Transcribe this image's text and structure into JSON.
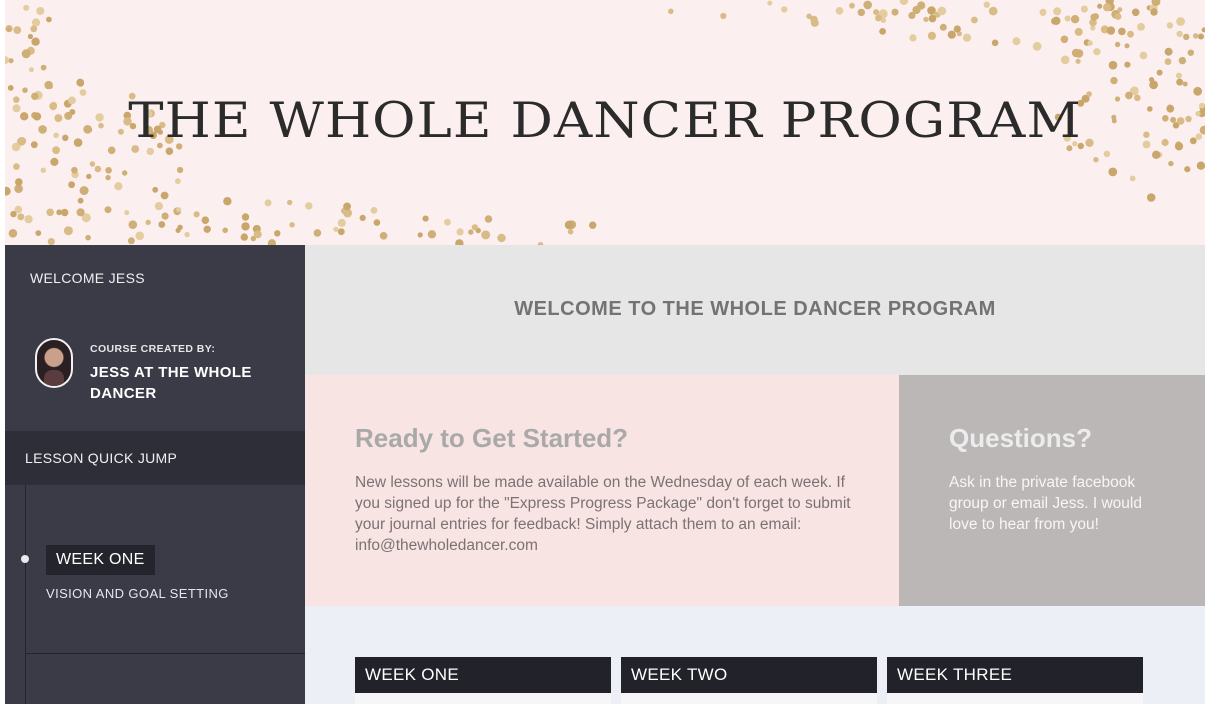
{
  "colors": {
    "hero_bg": "#fcefef",
    "confetti_gold": "#cfaf78",
    "sidebar_bg": "#3a3b47",
    "sidebar_dark": "#2d2e37",
    "header_bg": "#e6e6e6",
    "ready_bg": "#f9e4e4",
    "questions_bg": "#bbb7b6",
    "weeks_bg": "#edeff6",
    "week_card_header": "#22222a"
  },
  "hero": {
    "title": "THE WHOLE DANCER PROGRAM"
  },
  "sidebar": {
    "welcome": "WELCOME JESS",
    "creator_caption": "COURSE CREATED BY:",
    "creator_name": "JESS AT THE WHOLE DANCER",
    "avatar_icon": "profile-photo",
    "quick_jump_label": "LESSON QUICK JUMP",
    "lessons": [
      {
        "week": "WEEK ONE",
        "subtitle": "VISION AND GOAL SETTING",
        "active": true
      }
    ]
  },
  "main": {
    "header_title": "WELCOME TO THE WHOLE DANCER PROGRAM",
    "ready": {
      "title": "Ready to Get Started?",
      "body": "New lessons will be made available on the Wednesday of each week. If you signed up for the \"Express Progress Package\" don't forget to submit your journal entries for feedback! Simply attach them to an email: info@thewholedancer.com"
    },
    "questions": {
      "title": "Questions?",
      "body": "Ask in the private facebook group or email Jess. I would love to hear from you!"
    },
    "week_cards": [
      {
        "label": "WEEK ONE"
      },
      {
        "label": "WEEK TWO"
      },
      {
        "label": "WEEK THREE"
      }
    ]
  }
}
